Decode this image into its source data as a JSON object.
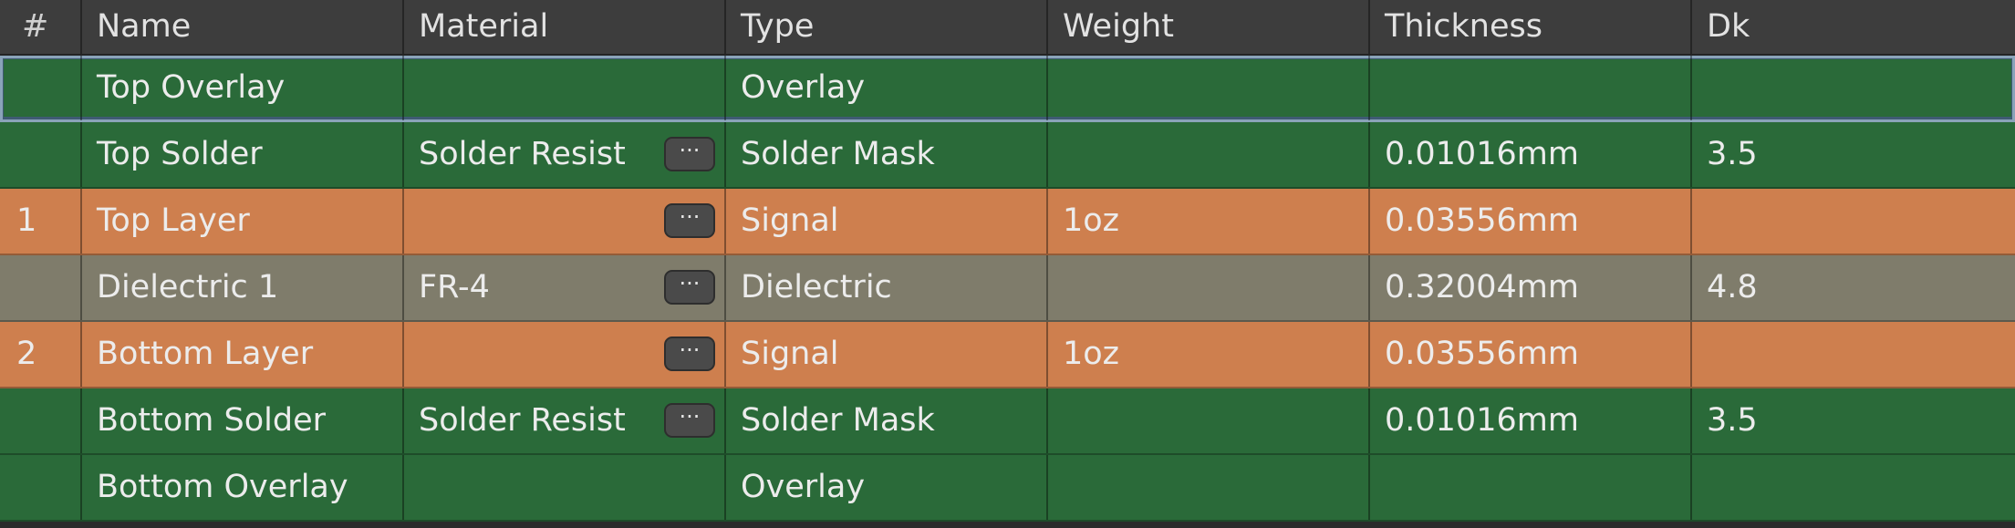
{
  "columns": [
    "#",
    "Name",
    "Material",
    "Type",
    "Weight",
    "Thickness",
    "Dk"
  ],
  "more_button_glyph": "···",
  "colors": {
    "overlay_mask": "#2a6a39",
    "signal": "#ce7f4e",
    "dielectric": "#7f7c6b",
    "header_bg": "#3d3d3d",
    "selection_border": "#8aa3b9"
  },
  "layers": [
    {
      "num": "",
      "name": "Top Overlay",
      "material": "",
      "type": "Overlay",
      "weight": "",
      "thickness": "",
      "dk": "",
      "kind": "overlay_mask",
      "has_button": false,
      "selected": true
    },
    {
      "num": "",
      "name": "Top Solder",
      "material": "Solder Resist",
      "type": "Solder Mask",
      "weight": "",
      "thickness": "0.01016mm",
      "dk": "3.5",
      "kind": "overlay_mask",
      "has_button": true,
      "selected": false
    },
    {
      "num": "1",
      "name": "Top Layer",
      "material": "",
      "type": "Signal",
      "weight": "1oz",
      "thickness": "0.03556mm",
      "dk": "",
      "kind": "signal",
      "has_button": true,
      "selected": false
    },
    {
      "num": "",
      "name": "Dielectric 1",
      "material": "FR-4",
      "type": "Dielectric",
      "weight": "",
      "thickness": "0.32004mm",
      "dk": "4.8",
      "kind": "dielectric",
      "has_button": true,
      "selected": false
    },
    {
      "num": "2",
      "name": "Bottom Layer",
      "material": "",
      "type": "Signal",
      "weight": "1oz",
      "thickness": "0.03556mm",
      "dk": "",
      "kind": "signal",
      "has_button": true,
      "selected": false
    },
    {
      "num": "",
      "name": "Bottom Solder",
      "material": "Solder Resist",
      "type": "Solder Mask",
      "weight": "",
      "thickness": "0.01016mm",
      "dk": "3.5",
      "kind": "overlay_mask",
      "has_button": true,
      "selected": false
    },
    {
      "num": "",
      "name": "Bottom Overlay",
      "material": "",
      "type": "Overlay",
      "weight": "",
      "thickness": "",
      "dk": "",
      "kind": "overlay_mask",
      "has_button": false,
      "selected": false
    }
  ]
}
